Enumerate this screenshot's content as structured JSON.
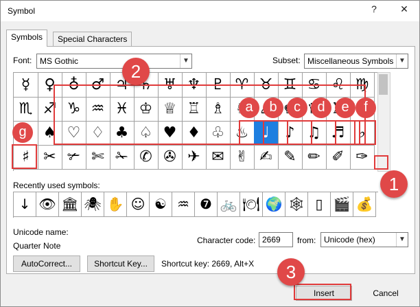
{
  "window": {
    "title": "Symbol",
    "help": "?",
    "close": "✕"
  },
  "tabs": [
    {
      "label": "Symbols"
    },
    {
      "label": "Special Characters"
    }
  ],
  "font": {
    "label": "Font:",
    "value": "MS Gothic"
  },
  "subset": {
    "label": "Subset:",
    "value": "Miscellaneous Symbols"
  },
  "grid_rows": [
    [
      "☿",
      "♀",
      "♁",
      "♂",
      "♃",
      "♄",
      "♅",
      "♆",
      "♇",
      "♈",
      "♉",
      "♊",
      "♋",
      "♌",
      "♍"
    ],
    [
      "♏",
      "♐",
      "♑",
      "♒",
      "♓",
      "♔",
      "♕",
      "♖",
      "♗",
      "♘",
      "♙",
      "♚",
      "♛",
      "♜",
      "♝"
    ],
    [
      "♞",
      "♠",
      "♡",
      "♢",
      "♣",
      "♤",
      "♥",
      "♦",
      "♧",
      "♨",
      "♩",
      "♪",
      "♫",
      "♬",
      "♭"
    ],
    [
      "♯",
      "✂",
      "✃",
      "✄",
      "✁",
      "✆",
      "✇",
      "✈",
      "✉",
      "✌",
      "✍",
      "✎",
      "✏",
      "✐",
      "✑"
    ]
  ],
  "recent": {
    "label": "Recently used symbols:",
    "items": [
      "↓",
      "👁",
      "🏛",
      "🕷",
      "✋",
      "☺",
      "☯",
      "♒",
      "❼",
      "🚲",
      "🍽",
      "🌍",
      "🕸",
      "▯",
      "🎬",
      "💰"
    ]
  },
  "unicode": {
    "name_label": "Unicode name:",
    "name_value": "Quarter Note"
  },
  "char_code": {
    "label": "Character code:",
    "value": "2669",
    "from_label": "from:",
    "from_value": "Unicode (hex)"
  },
  "buttons": {
    "autocorrect": "AutoCorrect...",
    "shortcut": "Shortcut Key...",
    "insert": "Insert",
    "cancel": "Cancel"
  },
  "shortcut_text": "Shortcut key: 2669, Alt+X",
  "annotations": {
    "one": "1",
    "two": "2",
    "three": "3",
    "letters": [
      "a",
      "b",
      "c",
      "d",
      "e",
      "f",
      "g"
    ]
  },
  "colors": {
    "accent": "#e04848",
    "selection": "#1e7fe0"
  }
}
